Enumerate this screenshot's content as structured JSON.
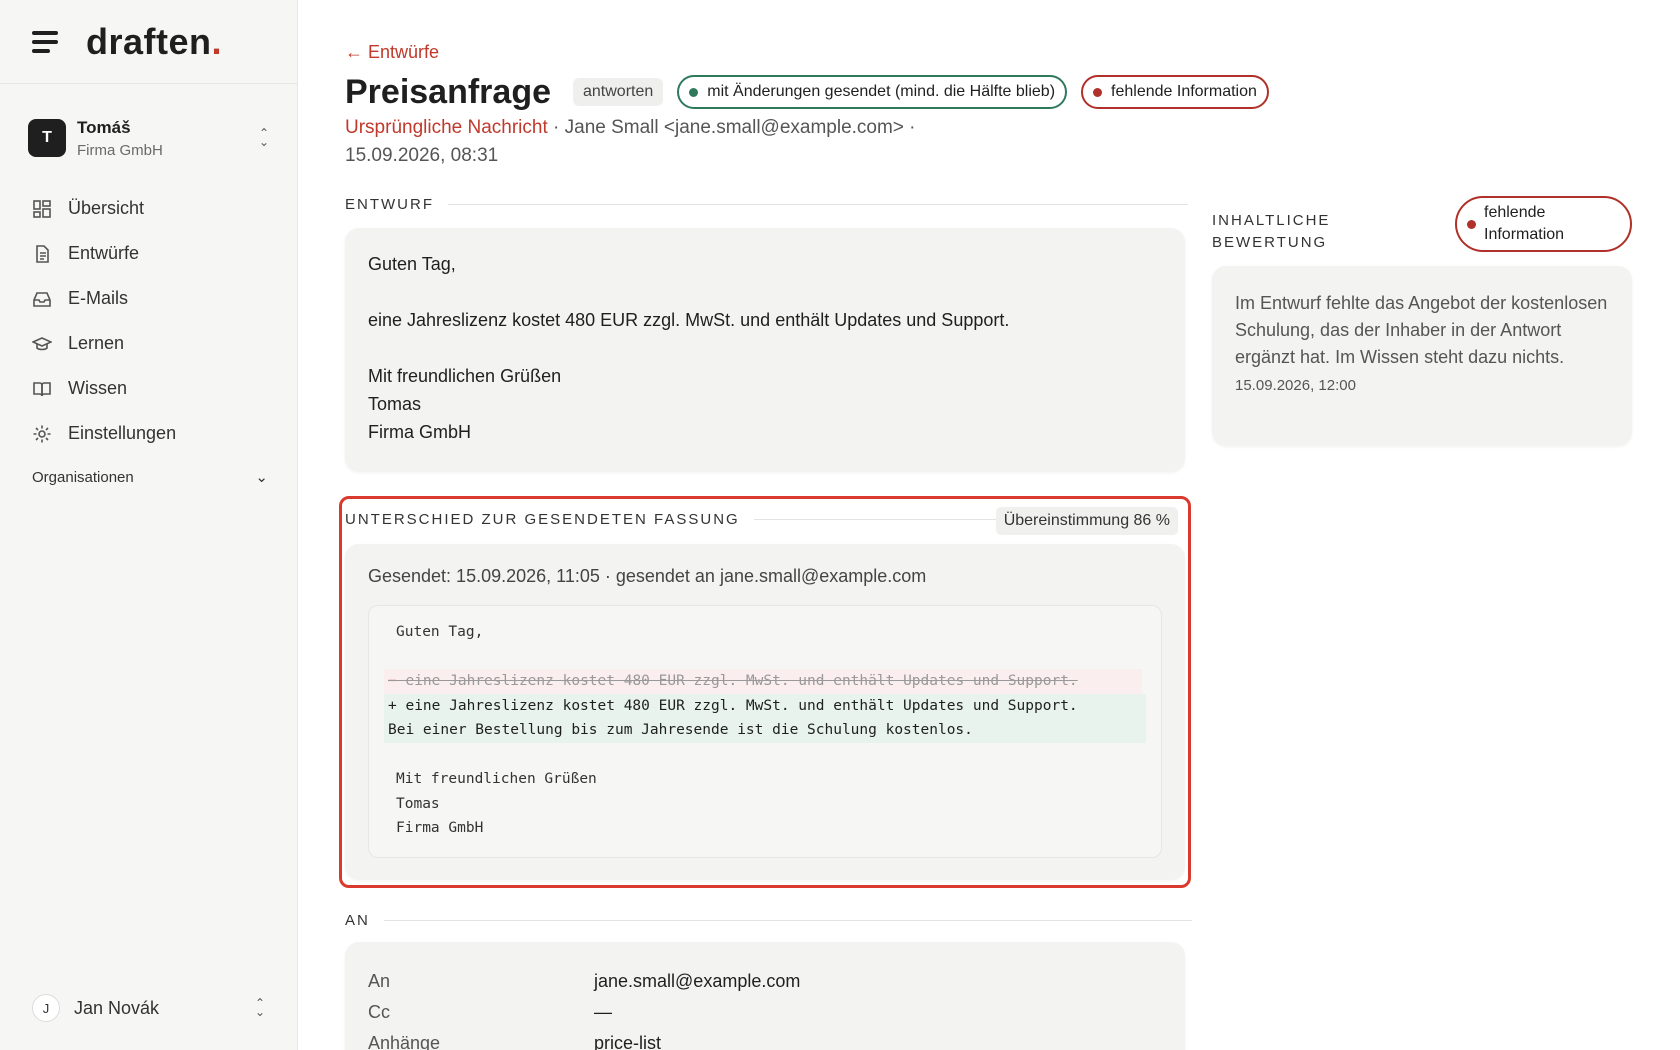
{
  "brand": {
    "name": "draften",
    "dot": "."
  },
  "account": {
    "initial": "T",
    "name": "Tomáš",
    "company": "Firma GmbH"
  },
  "nav": [
    {
      "label": "Übersicht",
      "icon": "dashboard-icon"
    },
    {
      "label": "Entwürfe",
      "icon": "document-icon"
    },
    {
      "label": "E-Mails",
      "icon": "inbox-icon"
    },
    {
      "label": "Lernen",
      "icon": "graduation-cap-icon"
    },
    {
      "label": "Wissen",
      "icon": "book-icon"
    },
    {
      "label": "Einstellungen",
      "icon": "gear-icon"
    }
  ],
  "organizations_label": "Organisationen",
  "user": {
    "initial": "J",
    "name": "Jan Novák"
  },
  "header": {
    "back_label": "← Entwürfe",
    "title": "Preisanfrage",
    "type_chip": "antworten",
    "status_pill": "mit Änderungen gesendet (mind. die Hälfte blieb)",
    "issue_pill": "fehlende Information",
    "original_link": "Ursprüngliche Nachricht",
    "sender": " · Jane Small <jane.small@example.com> ·",
    "date": "15.09.2026, 08:31"
  },
  "draft": {
    "heading": "ENTWURF",
    "lines": [
      "Guten Tag,",
      "",
      "eine Jahreslizenz kostet 480 EUR zzgl. MwSt. und enthält Updates und Support.",
      "",
      "Mit freundlichen Grüßen",
      "Tomas",
      "Firma GmbH"
    ]
  },
  "diff": {
    "heading": "UNTERSCHIED ZUR GESENDETEN FASSUNG",
    "match": "Übereinstimmung 86 %",
    "sent_info": "Gesendet: 15.09.2026, 11:05 · gesendet an jane.small@example.com",
    "line_greeting": "Guten Tag,",
    "removed": "eine Jahreslizenz kostet 480 EUR zzgl. MwSt. und enthält Updates und Support.",
    "added_1": "+ eine Jahreslizenz kostet 480 EUR zzgl. MwSt. und enthält Updates und Support.",
    "added_2": "Bei einer Bestellung bis zum Jahresende ist die Schulung kostenlos.",
    "closing_1": "Mit freundlichen Grüßen",
    "closing_2": "Tomas",
    "closing_3": "Firma GmbH"
  },
  "to": {
    "heading": "AN",
    "rows": [
      {
        "key": "An",
        "value": "jane.small@example.com"
      },
      {
        "key": "Cc",
        "value": "—"
      },
      {
        "key": "Anhänge",
        "value": "price-list"
      }
    ]
  },
  "assessment": {
    "heading_1": "INHALTLICHE",
    "heading_2": "BEWERTUNG",
    "pill_1": "fehlende",
    "pill_2": "Information",
    "text": "Im Entwurf fehlte das Angebot der kostenlosen Schulung, das der Inhaber in der Antwort ergänzt hat. Im Wissen steht dazu nichts.",
    "timestamp": "15.09.2026, 12:00"
  },
  "colors": {
    "accent": "#c0392b",
    "success": "#2f7a5c",
    "danger": "#b0302a",
    "highlight": "#d93a2d"
  }
}
